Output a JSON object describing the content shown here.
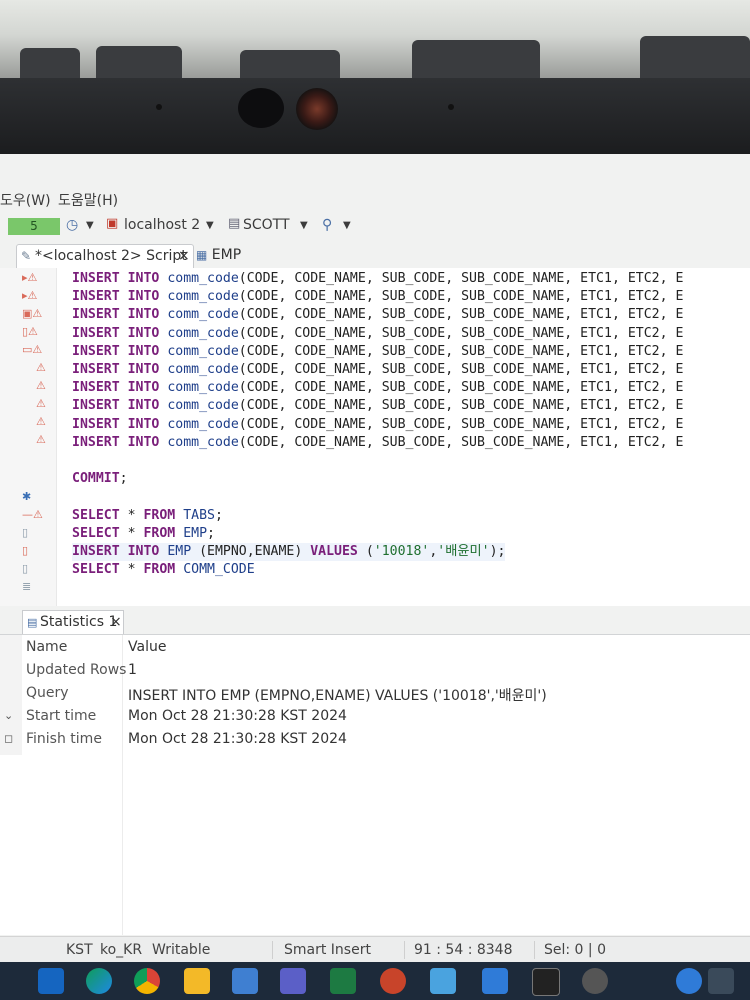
{
  "menu": {
    "window": "도우(W)",
    "help": "도움말(H)"
  },
  "toolbar": {
    "tx_count": "5",
    "connection": "localhost 2",
    "schema": "SCOTT"
  },
  "tabs": {
    "script": "*<localhost 2> Script",
    "script_close": "×",
    "emp": "EMP"
  },
  "editor": {
    "lines": [
      {
        "text": "INSERT INTO comm_code(CODE, CODE_NAME, SUB_CODE, SUB_CODE_NAME, ETC1, ETC2, E"
      },
      {
        "text": "INSERT INTO comm_code(CODE, CODE_NAME, SUB_CODE, SUB_CODE_NAME, ETC1, ETC2, E"
      },
      {
        "text": "INSERT INTO comm_code(CODE, CODE_NAME, SUB_CODE, SUB_CODE_NAME, ETC1, ETC2, E"
      },
      {
        "text": "INSERT INTO comm_code(CODE, CODE_NAME, SUB_CODE, SUB_CODE_NAME, ETC1, ETC2, E"
      },
      {
        "text": "INSERT INTO comm_code(CODE, CODE_NAME, SUB_CODE, SUB_CODE_NAME, ETC1, ETC2, E"
      },
      {
        "text": "INSERT INTO comm_code(CODE, CODE_NAME, SUB_CODE, SUB_CODE_NAME, ETC1, ETC2, E"
      },
      {
        "text": "INSERT INTO comm_code(CODE, CODE_NAME, SUB_CODE, SUB_CODE_NAME, ETC1, ETC2, E"
      },
      {
        "text": "INSERT INTO comm_code(CODE, CODE_NAME, SUB_CODE, SUB_CODE_NAME, ETC1, ETC2, E"
      },
      {
        "text": "INSERT INTO comm_code(CODE, CODE_NAME, SUB_CODE, SUB_CODE_NAME, ETC1, ETC2, E"
      },
      {
        "text": "INSERT INTO comm_code(CODE, CODE_NAME, SUB_CODE, SUB_CODE_NAME, ETC1, ETC2, E"
      },
      {
        "text": ""
      },
      {
        "text": "COMMIT;"
      },
      {
        "text": ""
      },
      {
        "text": "SELECT * FROM TABS;"
      },
      {
        "text": "SELECT * FROM EMP;"
      },
      {
        "text": "INSERT INTO EMP (EMPNO,ENAME) VALUES ('10018','배윤미');"
      },
      {
        "text": "SELECT * FROM COMM_CODE"
      }
    ],
    "scroll_left": "<"
  },
  "stats": {
    "tab_label": "Statistics 1",
    "tab_close": "×",
    "header": {
      "name": "Name",
      "value": "Value"
    },
    "rows": [
      {
        "name": "Updated Rows",
        "value": "1"
      },
      {
        "name": "Query",
        "value": "INSERT INTO EMP (EMPNO,ENAME) VALUES ('10018','배윤미')"
      },
      {
        "name": "Start time",
        "value": "Mon Oct 28 21:30:28 KST 2024"
      },
      {
        "name": "Finish time",
        "value": "Mon Oct 28 21:30:28 KST 2024"
      }
    ]
  },
  "status": {
    "timezone": "KST",
    "locale": "ko_KR",
    "mode": "Writable",
    "insert_mode": "Smart Insert",
    "position": "91 : 54 : 8348",
    "selection": "Sel: 0 | 0"
  },
  "colors": {
    "keyword": "#7a1f7a",
    "table": "#1f3f8a",
    "string": "#1f6f2f",
    "tx_badge": "#7ac76a",
    "taskbar": "#1d2a3a"
  }
}
